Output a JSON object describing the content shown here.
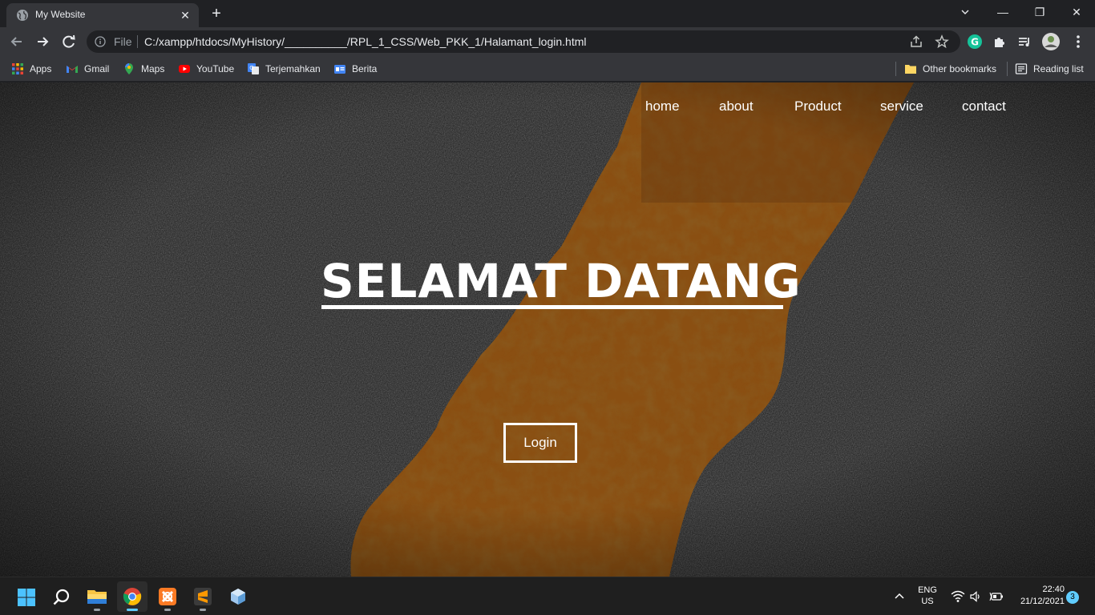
{
  "browser": {
    "tab_title": "My Website",
    "tab_close": "✕",
    "new_tab": "+",
    "window_controls": {
      "minimize": "—",
      "restore": "❐",
      "close": "✕"
    },
    "scheme_label": "File",
    "url": "C:/xampp/htdocs/MyHistory/__________/RPL_1_CSS/Web_PKK_1/Halamant_login.html",
    "bookmarks": [
      {
        "label": "Apps",
        "icon": "apps-grid-icon"
      },
      {
        "label": "Gmail",
        "icon": "gmail-icon"
      },
      {
        "label": "Maps",
        "icon": "maps-icon"
      },
      {
        "label": "YouTube",
        "icon": "youtube-icon"
      },
      {
        "label": "Terjemahkan",
        "icon": "translate-icon"
      },
      {
        "label": "Berita",
        "icon": "news-icon"
      }
    ],
    "other_bookmarks": "Other bookmarks",
    "reading_list": "Reading list"
  },
  "site": {
    "nav": [
      "home",
      "about",
      "Product",
      "service",
      "contact"
    ],
    "hero_title": "SELAMAT DATANG",
    "login_label": "Login"
  },
  "taskbar": {
    "apps": [
      "start-icon",
      "search-icon",
      "file-explorer-icon",
      "chrome-icon",
      "xampp-icon",
      "sublime-text-icon",
      "box-app-icon"
    ],
    "active_app": "chrome-icon",
    "language_line1": "ENG",
    "language_line2": "US",
    "time": "22:40",
    "date": "21/12/2021",
    "notification_count": "3"
  },
  "colors": {
    "browser_dark": "#202124",
    "browser_toolbar": "#35363a",
    "asphalt": "#1a1a1a",
    "rust_stripe": "#8a4f12",
    "accent": "#60cdff"
  }
}
